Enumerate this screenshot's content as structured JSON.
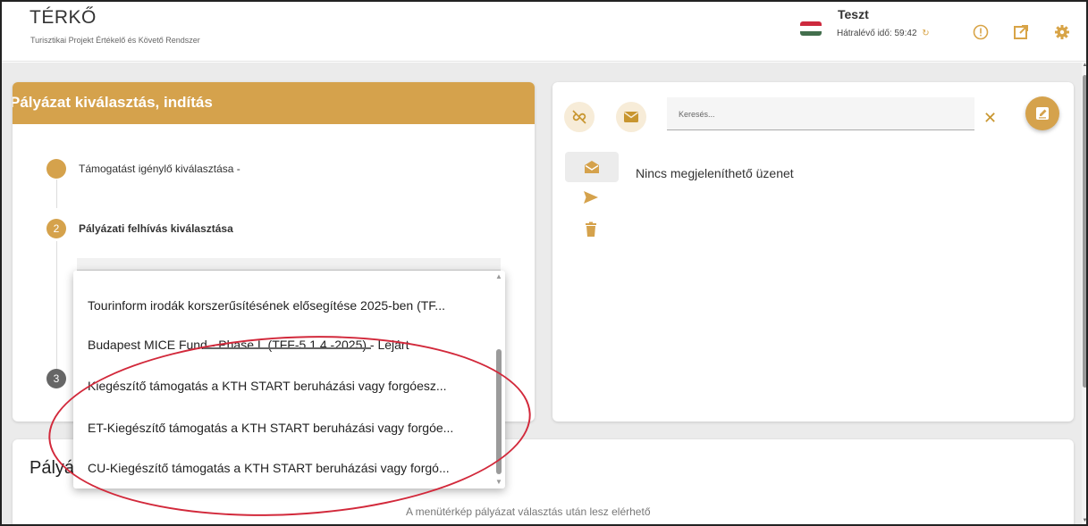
{
  "header": {
    "title": "TÉRKŐ",
    "subtitle": "Turisztikai Projekt Értékelő és Követő Rendszer",
    "user": "Teszt",
    "timer_label": "Hátralévő idő: 59:42"
  },
  "colors": {
    "accent": "#d5a24c",
    "annotation": "#d2293b",
    "background": "#ebebeb"
  },
  "icons": {
    "language": "hungarian-flag-icon",
    "refresh": "refresh-icon",
    "info": "info-icon",
    "external": "external-link-icon",
    "settings": "gear-icon",
    "unlink": "unlink-icon",
    "mail": "mail-icon",
    "compose": "compose-icon",
    "inbox": "inbox-open-icon",
    "send": "send-icon",
    "trash": "trash-icon",
    "close": "close-icon"
  },
  "left_card": {
    "title": "Pályázat kiválasztás, indítás",
    "steps": [
      {
        "number": "",
        "label": "Támogatást igénylő kiválasztása -"
      },
      {
        "number": "2",
        "label": "Pályázati felhívás kiválasztása"
      },
      {
        "number": "3",
        "label": ""
      }
    ]
  },
  "dropdown": {
    "options": [
      "Tourinform irodák korszerűsítésének elősegítése 2025-ben (TF...",
      "Budapest MICE Fund - Phase I. (TFF-5.1.4.-2025) - Lejárt",
      "Kiegészítő támogatás a KTH START beruházási vagy forgóesz...",
      "ET-Kiegészítő támogatás a KTH START beruházási vagy forgóe...",
      "CU-Kiegészítő támogatás a KTH START beruházási vagy forgó..."
    ]
  },
  "right_card": {
    "search_placeholder": "Keresés...",
    "empty_message": "Nincs megjeleníthető üzenet"
  },
  "bottom_card": {
    "title": "Pályá",
    "note": "A menütérkép pályázat választás után lesz elérhető"
  }
}
